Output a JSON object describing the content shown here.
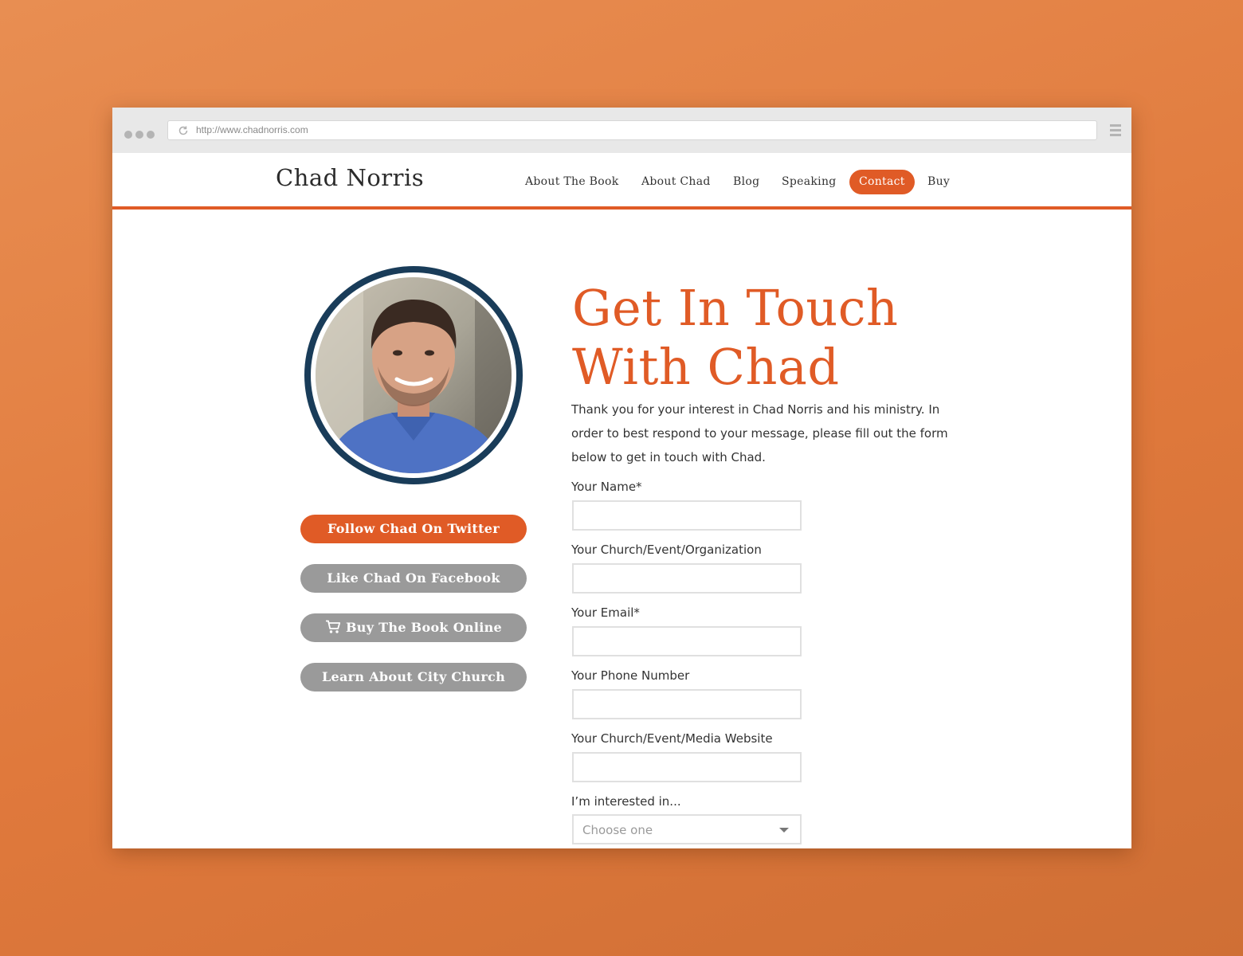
{
  "browser": {
    "url": "http://www.chadnorris.com"
  },
  "header": {
    "logo": "Chad Norris",
    "nav": [
      {
        "label": "About The Book"
      },
      {
        "label": "About Chad"
      },
      {
        "label": "Blog"
      },
      {
        "label": "Speaking"
      },
      {
        "label": "Contact",
        "active": true
      },
      {
        "label": "Buy"
      }
    ]
  },
  "sidebar": {
    "buttons": [
      {
        "label": "Follow Chad On Twitter",
        "style": "primary"
      },
      {
        "label": "Like Chad On Facebook",
        "style": "secondary"
      },
      {
        "label": "Buy The Book Online",
        "style": "secondary",
        "icon": "cart-icon"
      },
      {
        "label": "Learn About City Church",
        "style": "secondary"
      }
    ]
  },
  "main": {
    "heading_line1": "Get In Touch",
    "heading_line2": "With Chad",
    "intro": "Thank you for your interest in Chad Norris and his ministry. In order to best respond to your message, please fill out the form below to get in touch with Chad.",
    "form": {
      "fields": [
        {
          "label": "Your Name*",
          "value": ""
        },
        {
          "label": "Your Church/Event/Organization",
          "value": ""
        },
        {
          "label": "Your Email*",
          "value": ""
        },
        {
          "label": "Your Phone Number",
          "value": ""
        },
        {
          "label": "Your Church/Event/Media Website",
          "value": ""
        }
      ],
      "interest_label": "I’m interested in...",
      "interest_placeholder": "Choose one"
    }
  },
  "colors": {
    "accent": "#e05b26",
    "secondary_button": "#9a9a9a",
    "avatar_ring": "#193c59",
    "background": "#e4823f"
  }
}
